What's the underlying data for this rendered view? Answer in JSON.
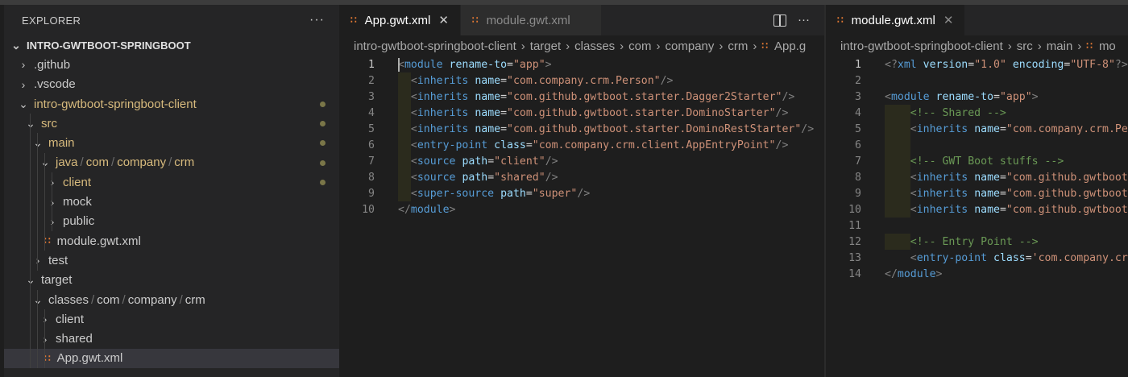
{
  "sidebar": {
    "title": "EXPLORER",
    "more": "···",
    "root": "INTRO-GWTBOOT-SPRINGBOOT",
    "items": [
      {
        "label": ".github",
        "depth": 1,
        "chev": "›",
        "type": "folder"
      },
      {
        "label": ".vscode",
        "depth": 1,
        "chev": "›",
        "type": "folder"
      },
      {
        "label": "intro-gwtboot-springboot-client",
        "depth": 1,
        "chev": "⌄",
        "type": "folder",
        "modified": true
      },
      {
        "label": "src",
        "depth": 2,
        "chev": "⌄",
        "type": "folder",
        "modified": true
      },
      {
        "label": "main",
        "depth": 3,
        "chev": "⌄",
        "type": "folder",
        "modified": true
      },
      {
        "label": "java/com/company/crm",
        "depth": 4,
        "chev": "⌄",
        "type": "folder",
        "modified": true
      },
      {
        "label": "client",
        "depth": 5,
        "chev": "›",
        "type": "folder",
        "modified": true
      },
      {
        "label": "mock",
        "depth": 5,
        "chev": "›",
        "type": "folder"
      },
      {
        "label": "public",
        "depth": 5,
        "chev": "›",
        "type": "folder"
      },
      {
        "label": "module.gwt.xml",
        "depth": 4,
        "type": "file"
      },
      {
        "label": "test",
        "depth": 3,
        "chev": "›",
        "type": "folder"
      },
      {
        "label": "target",
        "depth": 2,
        "chev": "⌄",
        "type": "folder"
      },
      {
        "label": "classes/com/company/crm",
        "depth": 3,
        "chev": "⌄",
        "type": "folder"
      },
      {
        "label": "client",
        "depth": 4,
        "chev": "›",
        "type": "folder"
      },
      {
        "label": "shared",
        "depth": 4,
        "chev": "›",
        "type": "folder"
      },
      {
        "label": "App.gwt.xml",
        "depth": 4,
        "type": "file",
        "selected": true
      }
    ]
  },
  "editor1": {
    "tabs": [
      {
        "label": "App.gwt.xml",
        "active": true,
        "close": "✕"
      },
      {
        "label": "module.gwt.xml",
        "active": false
      }
    ],
    "actions_more": "···",
    "breadcrumbs": [
      "intro-gwtboot-springboot-client",
      "target",
      "classes",
      "com",
      "company",
      "crm",
      "App.g"
    ],
    "lines": [
      {
        "n": "1",
        "tokens": [
          [
            "br",
            "<"
          ],
          [
            "tag",
            "module"
          ],
          [
            "txt",
            " "
          ],
          [
            "attr",
            "rename-to"
          ],
          [
            "txt",
            "="
          ],
          [
            "str",
            "\"app\""
          ],
          [
            "br",
            ">"
          ]
        ]
      },
      {
        "n": "2",
        "tokens": [
          [
            "txt",
            "  "
          ],
          [
            "br",
            "<"
          ],
          [
            "tag",
            "inherits"
          ],
          [
            "txt",
            " "
          ],
          [
            "attr",
            "name"
          ],
          [
            "txt",
            "="
          ],
          [
            "str",
            "\"com.company.crm.Person\""
          ],
          [
            "br",
            "/>"
          ]
        ]
      },
      {
        "n": "3",
        "tokens": [
          [
            "txt",
            "  "
          ],
          [
            "br",
            "<"
          ],
          [
            "tag",
            "inherits"
          ],
          [
            "txt",
            " "
          ],
          [
            "attr",
            "name"
          ],
          [
            "txt",
            "="
          ],
          [
            "str",
            "\"com.github.gwtboot.starter.Dagger2Starter\""
          ],
          [
            "br",
            "/>"
          ]
        ]
      },
      {
        "n": "4",
        "tokens": [
          [
            "txt",
            "  "
          ],
          [
            "br",
            "<"
          ],
          [
            "tag",
            "inherits"
          ],
          [
            "txt",
            " "
          ],
          [
            "attr",
            "name"
          ],
          [
            "txt",
            "="
          ],
          [
            "str",
            "\"com.github.gwtboot.starter.DominoStarter\""
          ],
          [
            "br",
            "/>"
          ]
        ]
      },
      {
        "n": "5",
        "tokens": [
          [
            "txt",
            "  "
          ],
          [
            "br",
            "<"
          ],
          [
            "tag",
            "inherits"
          ],
          [
            "txt",
            " "
          ],
          [
            "attr",
            "name"
          ],
          [
            "txt",
            "="
          ],
          [
            "str",
            "\"com.github.gwtboot.starter.DominoRestStarter\""
          ],
          [
            "br",
            "/>"
          ]
        ]
      },
      {
        "n": "6",
        "tokens": [
          [
            "txt",
            "  "
          ],
          [
            "br",
            "<"
          ],
          [
            "tag",
            "entry-point"
          ],
          [
            "txt",
            " "
          ],
          [
            "attr",
            "class"
          ],
          [
            "txt",
            "="
          ],
          [
            "str",
            "\"com.company.crm.client.AppEntryPoint\""
          ],
          [
            "br",
            "/>"
          ]
        ]
      },
      {
        "n": "7",
        "tokens": [
          [
            "txt",
            "  "
          ],
          [
            "br",
            "<"
          ],
          [
            "tag",
            "source"
          ],
          [
            "txt",
            " "
          ],
          [
            "attr",
            "path"
          ],
          [
            "txt",
            "="
          ],
          [
            "str",
            "\"client\""
          ],
          [
            "br",
            "/>"
          ]
        ]
      },
      {
        "n": "8",
        "tokens": [
          [
            "txt",
            "  "
          ],
          [
            "br",
            "<"
          ],
          [
            "tag",
            "source"
          ],
          [
            "txt",
            " "
          ],
          [
            "attr",
            "path"
          ],
          [
            "txt",
            "="
          ],
          [
            "str",
            "\"shared\""
          ],
          [
            "br",
            "/>"
          ]
        ]
      },
      {
        "n": "9",
        "tokens": [
          [
            "txt",
            "  "
          ],
          [
            "br",
            "<"
          ],
          [
            "tag",
            "super-source"
          ],
          [
            "txt",
            " "
          ],
          [
            "attr",
            "path"
          ],
          [
            "txt",
            "="
          ],
          [
            "str",
            "\"super\""
          ],
          [
            "br",
            "/>"
          ]
        ]
      },
      {
        "n": "10",
        "tokens": [
          [
            "br",
            "</"
          ],
          [
            "tag",
            "module"
          ],
          [
            "br",
            ">"
          ]
        ]
      }
    ]
  },
  "editor2": {
    "tabs": [
      {
        "label": "module.gwt.xml",
        "active": true,
        "close": "✕"
      }
    ],
    "breadcrumbs": [
      "intro-gwtboot-springboot-client",
      "src",
      "main",
      "mo"
    ],
    "lines": [
      {
        "n": "1",
        "tokens": [
          [
            "br",
            "<?"
          ],
          [
            "tag",
            "xml"
          ],
          [
            "txt",
            " "
          ],
          [
            "attr",
            "version"
          ],
          [
            "txt",
            "="
          ],
          [
            "str",
            "\"1.0\""
          ],
          [
            "txt",
            " "
          ],
          [
            "attr",
            "encoding"
          ],
          [
            "txt",
            "="
          ],
          [
            "str",
            "\"UTF-8\""
          ],
          [
            "br",
            "?>"
          ]
        ]
      },
      {
        "n": "2",
        "tokens": []
      },
      {
        "n": "3",
        "tokens": [
          [
            "br",
            "<"
          ],
          [
            "tag",
            "module"
          ],
          [
            "txt",
            " "
          ],
          [
            "attr",
            "rename-to"
          ],
          [
            "txt",
            "="
          ],
          [
            "str",
            "\"app\""
          ],
          [
            "br",
            ">"
          ]
        ]
      },
      {
        "n": "4",
        "tokens": [
          [
            "txt",
            "    "
          ],
          [
            "cmt",
            "<!-- Shared -->"
          ]
        ]
      },
      {
        "n": "5",
        "tokens": [
          [
            "txt",
            "    "
          ],
          [
            "br",
            "<"
          ],
          [
            "tag",
            "inherits"
          ],
          [
            "txt",
            " "
          ],
          [
            "attr",
            "name"
          ],
          [
            "txt",
            "="
          ],
          [
            "str",
            "\"com.company.crm.Pe"
          ]
        ]
      },
      {
        "n": "6",
        "tokens": []
      },
      {
        "n": "7",
        "tokens": [
          [
            "txt",
            "    "
          ],
          [
            "cmt",
            "<!-- GWT Boot stuffs -->"
          ]
        ]
      },
      {
        "n": "8",
        "tokens": [
          [
            "txt",
            "    "
          ],
          [
            "br",
            "<"
          ],
          [
            "tag",
            "inherits"
          ],
          [
            "txt",
            " "
          ],
          [
            "attr",
            "name"
          ],
          [
            "txt",
            "="
          ],
          [
            "str",
            "\"com.github.gwtboot"
          ]
        ]
      },
      {
        "n": "9",
        "tokens": [
          [
            "txt",
            "    "
          ],
          [
            "br",
            "<"
          ],
          [
            "tag",
            "inherits"
          ],
          [
            "txt",
            " "
          ],
          [
            "attr",
            "name"
          ],
          [
            "txt",
            "="
          ],
          [
            "str",
            "\"com.github.gwtboot"
          ]
        ]
      },
      {
        "n": "10",
        "tokens": [
          [
            "txt",
            "    "
          ],
          [
            "br",
            "<"
          ],
          [
            "tag",
            "inherits"
          ],
          [
            "txt",
            " "
          ],
          [
            "attr",
            "name"
          ],
          [
            "txt",
            "="
          ],
          [
            "str",
            "\"com.github.gwtboot"
          ]
        ]
      },
      {
        "n": "11",
        "tokens": []
      },
      {
        "n": "12",
        "tokens": [
          [
            "txt",
            "    "
          ],
          [
            "cmt",
            "<!-- Entry Point -->"
          ]
        ]
      },
      {
        "n": "13",
        "tokens": [
          [
            "txt",
            "    "
          ],
          [
            "br",
            "<"
          ],
          [
            "tag",
            "entry-point"
          ],
          [
            "txt",
            " "
          ],
          [
            "attr",
            "class"
          ],
          [
            "txt",
            "="
          ],
          [
            "str",
            "'com.company.cr"
          ]
        ]
      },
      {
        "n": "14",
        "tokens": [
          [
            "br",
            "</"
          ],
          [
            "tag",
            "module"
          ],
          [
            "br",
            ">"
          ]
        ]
      }
    ]
  }
}
